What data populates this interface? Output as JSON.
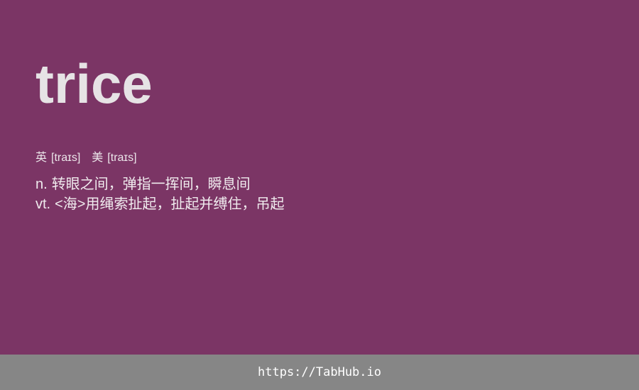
{
  "word": "trice",
  "phonetics": [
    {
      "region": "英",
      "ipa": "[traɪs]"
    },
    {
      "region": "美",
      "ipa": "[traɪs]"
    }
  ],
  "definitions": [
    {
      "pos": "n.",
      "text": "转眼之间，弹指一挥间，瞬息间"
    },
    {
      "pos": "vt.",
      "text": "<海>用绳索扯起，扯起并缚住，吊起"
    }
  ],
  "footer": {
    "url": "https://TabHub.io"
  },
  "colors": {
    "background": "#7b3565",
    "footer": "#868686",
    "text": "#e6e3e5"
  }
}
